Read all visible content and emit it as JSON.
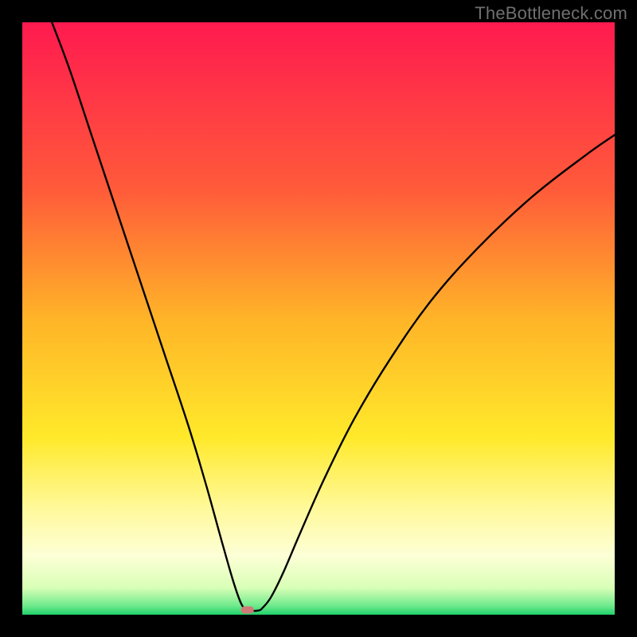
{
  "watermark": "TheBottleneck.com",
  "chart_data": {
    "type": "line",
    "title": "",
    "xlabel": "",
    "ylabel": "",
    "xlim": [
      0,
      100
    ],
    "ylim": [
      0,
      100
    ],
    "min_x": 38,
    "gradient_stops": [
      {
        "offset": 0.0,
        "color": "#ff1a4f"
      },
      {
        "offset": 0.28,
        "color": "#ff5a3a"
      },
      {
        "offset": 0.5,
        "color": "#ffb428"
      },
      {
        "offset": 0.7,
        "color": "#ffe92a"
      },
      {
        "offset": 0.82,
        "color": "#fff99a"
      },
      {
        "offset": 0.9,
        "color": "#fdffd6"
      },
      {
        "offset": 0.955,
        "color": "#d8ffb6"
      },
      {
        "offset": 0.985,
        "color": "#6eea8c"
      },
      {
        "offset": 1.0,
        "color": "#1fd06a"
      }
    ],
    "marker": {
      "x": 38,
      "y": 0.8,
      "color": "#cf7a77"
    },
    "series": [
      {
        "name": "curve",
        "points": [
          {
            "x": 5.0,
            "y": 100.0
          },
          {
            "x": 8.0,
            "y": 92.0
          },
          {
            "x": 12.0,
            "y": 80.0
          },
          {
            "x": 16.0,
            "y": 68.0
          },
          {
            "x": 20.0,
            "y": 56.0
          },
          {
            "x": 24.0,
            "y": 44.0
          },
          {
            "x": 28.0,
            "y": 32.0
          },
          {
            "x": 31.0,
            "y": 22.0
          },
          {
            "x": 33.5,
            "y": 13.0
          },
          {
            "x": 35.5,
            "y": 6.0
          },
          {
            "x": 36.8,
            "y": 2.2
          },
          {
            "x": 37.6,
            "y": 0.9
          },
          {
            "x": 38.0,
            "y": 0.7
          },
          {
            "x": 39.8,
            "y": 0.7
          },
          {
            "x": 40.6,
            "y": 1.2
          },
          {
            "x": 42.0,
            "y": 3.0
          },
          {
            "x": 44.0,
            "y": 7.0
          },
          {
            "x": 47.0,
            "y": 14.0
          },
          {
            "x": 51.0,
            "y": 23.0
          },
          {
            "x": 56.0,
            "y": 33.0
          },
          {
            "x": 62.0,
            "y": 43.0
          },
          {
            "x": 69.0,
            "y": 53.0
          },
          {
            "x": 77.0,
            "y": 62.0
          },
          {
            "x": 86.0,
            "y": 70.5
          },
          {
            "x": 95.0,
            "y": 77.5
          },
          {
            "x": 100.0,
            "y": 81.0
          }
        ]
      }
    ]
  }
}
